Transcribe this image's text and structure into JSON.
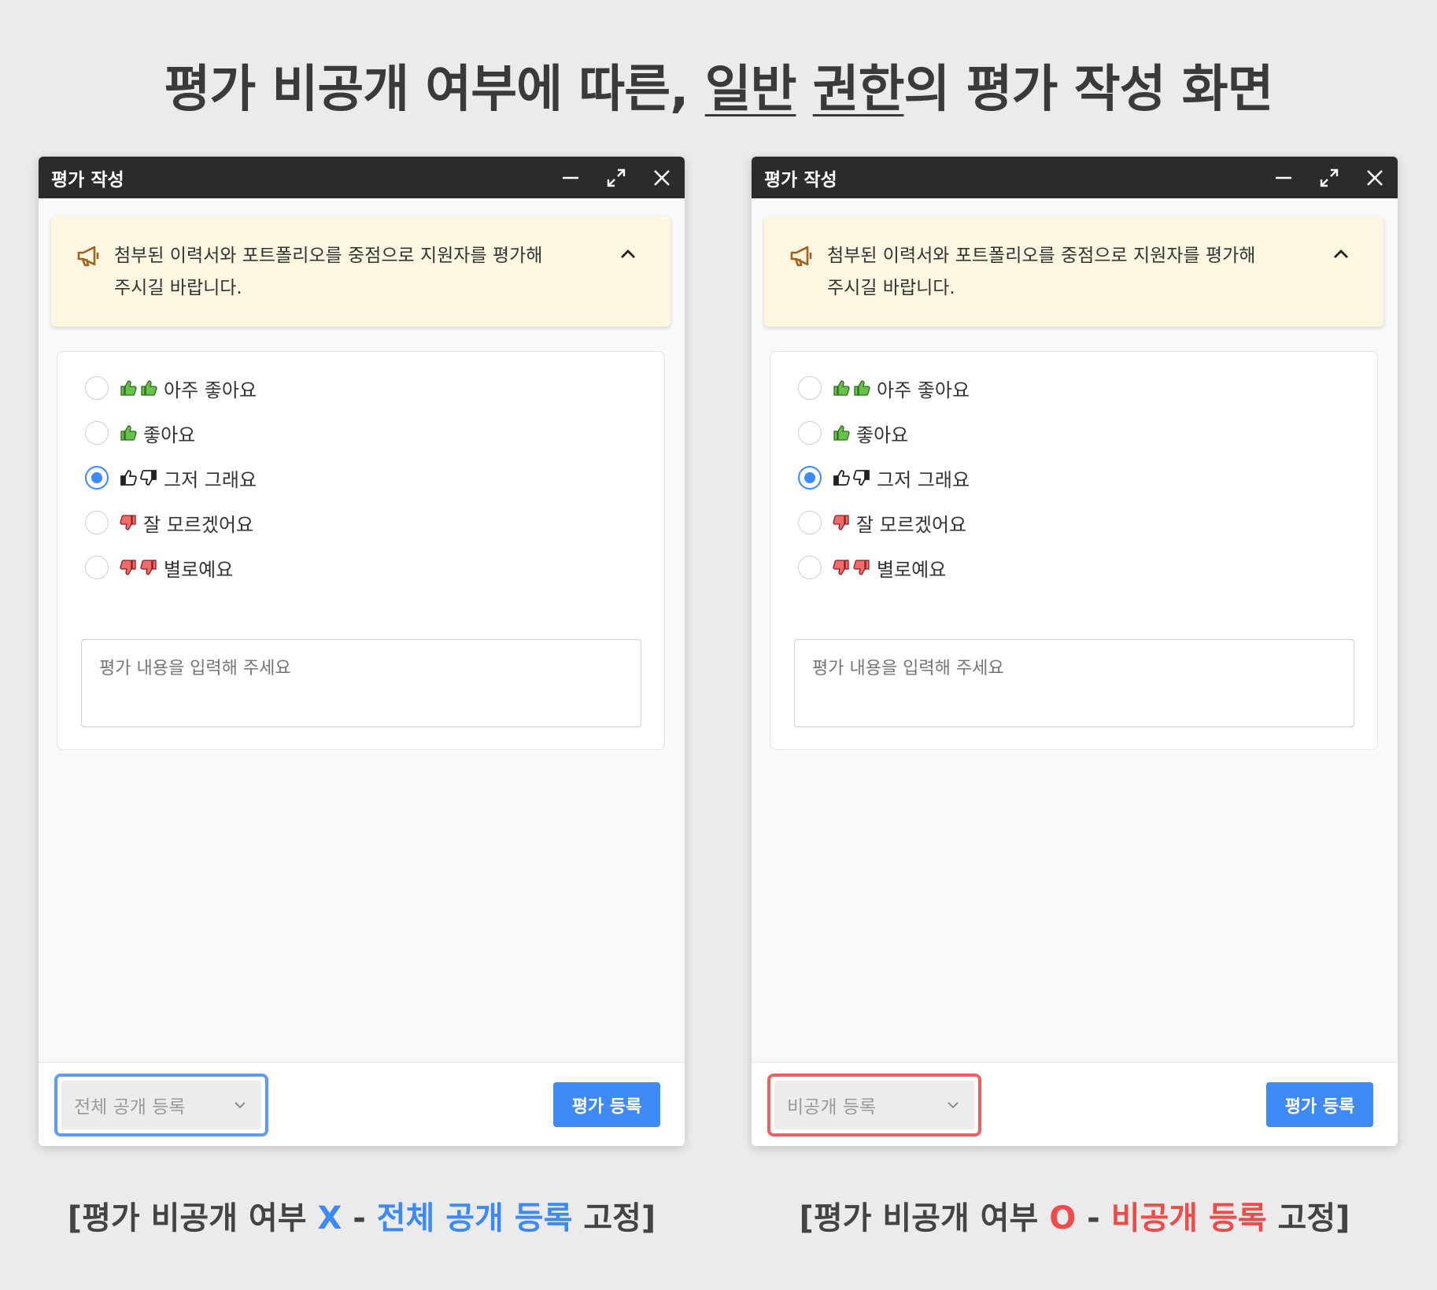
{
  "headline": {
    "part1": "평가 비공개 여부에 따른, ",
    "underline1": "일반",
    "space": " ",
    "underline2": "권한",
    "part2": "의 평가 작성 화면"
  },
  "panels": [
    {
      "window_title": "평가 작성",
      "notice": "첨부된 이력서와 포트폴리오를 중점으로 지원자를 평가해주시길 바랍니다.",
      "options": [
        {
          "label": "아주 좋아요",
          "icons": [
            "thumbs-up-green",
            "thumbs-up-green"
          ],
          "selected": false
        },
        {
          "label": "좋아요",
          "icons": [
            "thumbs-up-green"
          ],
          "selected": false
        },
        {
          "label": "그저 그래요",
          "icons": [
            "thumbs-up-black",
            "thumbs-down-black"
          ],
          "selected": true
        },
        {
          "label": "잘 모르겠어요",
          "icons": [
            "thumbs-down-red"
          ],
          "selected": false
        },
        {
          "label": "별로예요",
          "icons": [
            "thumbs-down-red",
            "thumbs-down-red"
          ],
          "selected": false
        }
      ],
      "textarea_placeholder": "평가 내용을 입력해 주세요",
      "visibility_select": "전체 공개 등록",
      "submit_label": "평가 등록",
      "highlight_color": "#5a9cf7",
      "caption": {
        "prefix": "[평가 비공개 여부 ",
        "flag": "X",
        "dash": " - ",
        "highlight": "전체 공개 등록",
        "suffix": " 고정]"
      }
    },
    {
      "window_title": "평가 작성",
      "notice": "첨부된 이력서와 포트폴리오를 중점으로 지원자를 평가해주시길 바랍니다.",
      "options": [
        {
          "label": "아주 좋아요",
          "icons": [
            "thumbs-up-green",
            "thumbs-up-green"
          ],
          "selected": false
        },
        {
          "label": "좋아요",
          "icons": [
            "thumbs-up-green"
          ],
          "selected": false
        },
        {
          "label": "그저 그래요",
          "icons": [
            "thumbs-up-black",
            "thumbs-down-black"
          ],
          "selected": true
        },
        {
          "label": "잘 모르겠어요",
          "icons": [
            "thumbs-down-red"
          ],
          "selected": false
        },
        {
          "label": "별로예요",
          "icons": [
            "thumbs-down-red",
            "thumbs-down-red"
          ],
          "selected": false
        }
      ],
      "textarea_placeholder": "평가 내용을 입력해 주세요",
      "visibility_select": "비공개 등록",
      "submit_label": "평가 등록",
      "highlight_color": "#f06060",
      "caption": {
        "prefix": "[평가 비공개 여부 ",
        "flag": "O",
        "dash": " - ",
        "highlight": "비공개 등록",
        "suffix": " 고정]"
      }
    }
  ],
  "colors": {
    "accent_blue": "#3d8af7",
    "accent_red": "#f04b4b",
    "notice_bg": "#fdf7e1",
    "titlebar_bg": "#2b2b2b",
    "thumb_green": "#66c24a",
    "thumb_red": "#f06b6b"
  }
}
